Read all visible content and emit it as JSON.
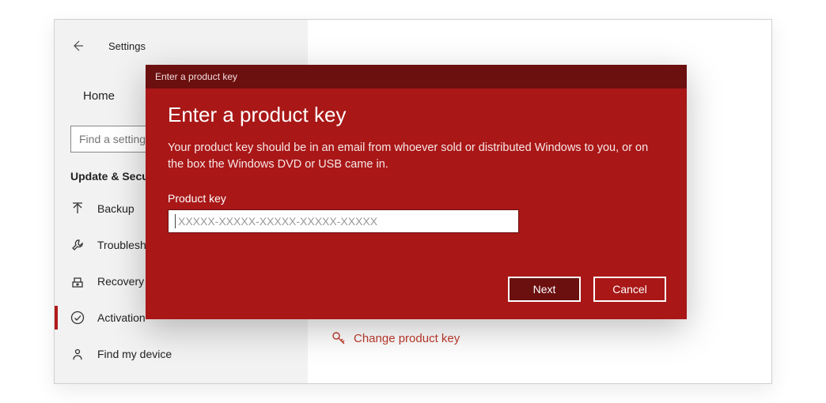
{
  "window": {
    "app_title": "Settings"
  },
  "sidebar": {
    "home_label": "Home",
    "search_placeholder": "Find a setting",
    "section_header": "Update & Security",
    "items": [
      {
        "label": "Backup"
      },
      {
        "label": "Troubleshoot"
      },
      {
        "label": "Recovery"
      },
      {
        "label": "Activation"
      },
      {
        "label": "Find my device"
      }
    ]
  },
  "content": {
    "change_key_label": "Change product key"
  },
  "modal": {
    "titlebar": "Enter a product key",
    "heading": "Enter a product key",
    "description": "Your product key should be in an email from whoever sold or distributed Windows to you, or on the box the Windows DVD or USB came in.",
    "field_label": "Product key",
    "input_placeholder": "XXXXX-XXXXX-XXXXX-XXXXX-XXXXX",
    "input_value": "",
    "next_label": "Next",
    "cancel_label": "Cancel"
  },
  "colors": {
    "accent_red": "#a91717",
    "accent_red_dark": "#6b0f0f",
    "link_red": "#c0392b"
  }
}
